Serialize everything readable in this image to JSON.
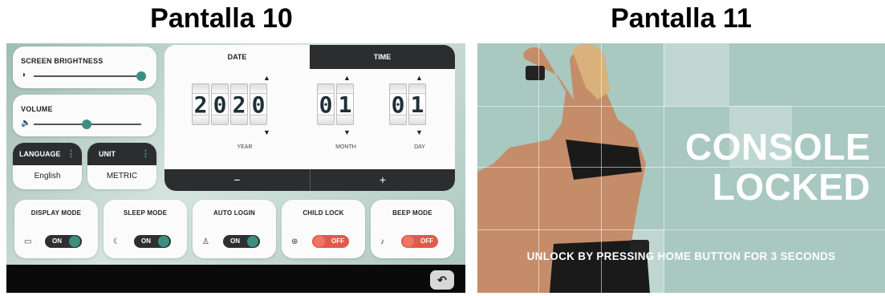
{
  "headings": {
    "screen10": "Pantalla 10",
    "screen11": "Pantalla 11"
  },
  "screen10": {
    "brightness": {
      "label": "SCREEN BRIGHTNESS",
      "icon": "brightness-icon",
      "level": 1.0
    },
    "volume": {
      "label": "VOLUME",
      "icon": "speaker-icon",
      "level": 0.45
    },
    "language": {
      "label": "LANGUAGE",
      "value": "English",
      "menu_glyph": "⋮"
    },
    "unit": {
      "label": "UNIT",
      "value": "METRIC",
      "menu_glyph": "⋮"
    },
    "datetime": {
      "tab_date": "DATE",
      "tab_time": "TIME",
      "year": [
        "2",
        "0",
        "2",
        "0"
      ],
      "month": [
        "0",
        "1"
      ],
      "day": [
        "0",
        "1"
      ],
      "year_label": "YEAR",
      "month_label": "MONTH",
      "day_label": "DAY",
      "minus": "−",
      "plus": "+"
    },
    "modes": [
      {
        "label": "DISPLAY MODE",
        "state": "ON",
        "icon": "display-icon"
      },
      {
        "label": "SLEEP MODE",
        "state": "ON",
        "icon": "sleep-icon"
      },
      {
        "label": "AUTO LOGIN",
        "state": "ON",
        "icon": "user-icon"
      },
      {
        "label": "CHILD LOCK",
        "state": "OFF",
        "icon": "lock-icon"
      },
      {
        "label": "BEEP MODE",
        "state": "OFF",
        "icon": "sound-icon"
      }
    ],
    "colors": {
      "accent": "#3b8f7e",
      "off": "#e05a4a",
      "dark": "#2b2d2f"
    }
  },
  "screen11": {
    "title_line1": "CONSOLE",
    "title_line2": "LOCKED",
    "instruction": "UNLOCK BY PRESSING HOME BUTTON FOR 3 SECONDS"
  }
}
